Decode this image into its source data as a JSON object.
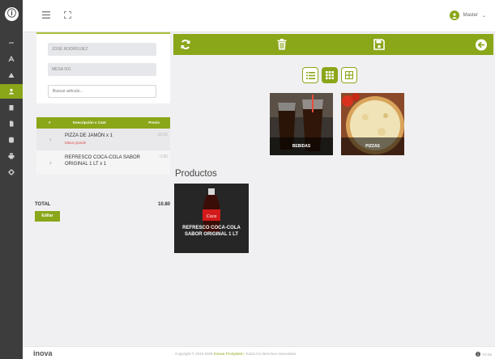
{
  "sidebar": {
    "logo": "ⓘ",
    "items": [
      {
        "icon": "minus-icon"
      },
      {
        "icon": "font-icon"
      },
      {
        "icon": "triangle-icon"
      },
      {
        "icon": "users-icon",
        "active": true
      },
      {
        "icon": "building-icon"
      },
      {
        "icon": "document-icon"
      },
      {
        "icon": "database-icon"
      },
      {
        "icon": "printer-icon"
      },
      {
        "icon": "gear-icon"
      }
    ]
  },
  "header": {
    "user_name": "Master",
    "caret": "⌄"
  },
  "customer": {
    "name": "JOSÉ RODRÍGUEZ",
    "table": "MESA 001",
    "search_placeholder": "Buscar artículo..."
  },
  "order": {
    "columns": {
      "num": "#",
      "desc": "Descripción x Cant",
      "price": "Precio"
    },
    "items": [
      {
        "num": "1",
        "desc": "PIZZA DE JAMÓN x 1",
        "sub": "Masa grande",
        "price": "10.00"
      },
      {
        "num": "2",
        "desc": "REFRESCO COCA-COLA SABOR ORIGINAL 1 LT x 1",
        "price": "0.80"
      }
    ],
    "total_label": "TOTAL",
    "total_value": "10.80",
    "edit_label": "Editar"
  },
  "categories": [
    {
      "label": "BEBIDAS"
    },
    {
      "label": "PIZZAS"
    }
  ],
  "products": {
    "title": "Productos",
    "items": [
      {
        "label": "REFRESCO COCA-COLA SABOR ORIGINAL 1 LT",
        "bottle_text": "Coca"
      }
    ]
  },
  "footer": {
    "brand": "inova",
    "copy_prefix": "Copyright © 2015-2025",
    "copy_brand": "Innova ProSystem.",
    "copy_suffix": "Todos los derechos reservados.",
    "version": "V2.56"
  },
  "colors": {
    "accent": "#8aa619",
    "sidebar": "#3d3d3d",
    "danger": "#e0504e"
  }
}
